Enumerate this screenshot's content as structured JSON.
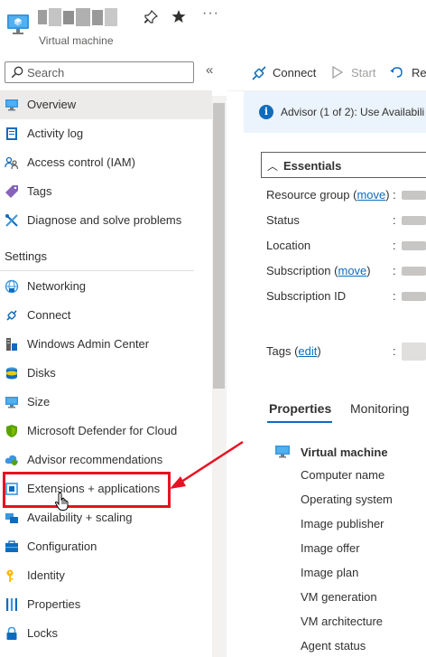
{
  "header": {
    "vm_subtitle": "Virtual machine",
    "pin_icon": "pin-icon",
    "star_icon": "star-icon",
    "more_label": "···"
  },
  "sidebar": {
    "search_placeholder": "Search",
    "collapse_label": "«",
    "items_top": [
      {
        "label": "Overview",
        "icon": "monitor-icon"
      },
      {
        "label": "Activity log",
        "icon": "activity-log-icon"
      },
      {
        "label": "Access control (IAM)",
        "icon": "people-icon"
      },
      {
        "label": "Tags",
        "icon": "tag-icon"
      },
      {
        "label": "Diagnose and solve problems",
        "icon": "wrench-icon"
      }
    ],
    "settings_title": "Settings",
    "items_settings": [
      {
        "label": "Networking",
        "icon": "network-icon"
      },
      {
        "label": "Connect",
        "icon": "connect-icon"
      },
      {
        "label": "Windows Admin Center",
        "icon": "admin-center-icon"
      },
      {
        "label": "Disks",
        "icon": "disks-icon"
      },
      {
        "label": "Size",
        "icon": "size-icon"
      },
      {
        "label": "Microsoft Defender for Cloud",
        "icon": "shield-icon"
      },
      {
        "label": "Advisor recommendations",
        "icon": "advisor-icon"
      },
      {
        "label": "Extensions + applications",
        "icon": "extensions-icon"
      },
      {
        "label": "Availability + scaling",
        "icon": "availability-icon"
      },
      {
        "label": "Configuration",
        "icon": "configuration-icon"
      },
      {
        "label": "Identity",
        "icon": "identity-key-icon"
      },
      {
        "label": "Properties",
        "icon": "properties-icon"
      },
      {
        "label": "Locks",
        "icon": "lock-icon"
      }
    ]
  },
  "toolbar": {
    "connect_label": "Connect",
    "start_label": "Start",
    "restart_label": "Res"
  },
  "advisor": {
    "text": "Advisor (1 of 2): Use Availabili"
  },
  "essentials": {
    "title": "Essentials",
    "rows": {
      "resource_group": "Resource group",
      "resource_group_link": "move",
      "status": "Status",
      "location": "Location",
      "subscription": "Subscription",
      "subscription_link": "move",
      "subscription_id": "Subscription ID",
      "tags": "Tags",
      "tags_link": "edit"
    }
  },
  "tabs": {
    "properties": "Properties",
    "monitoring": "Monitoring"
  },
  "vm_properties": {
    "section_title": "Virtual machine",
    "items": [
      "Computer name",
      "Operating system",
      "Image publisher",
      "Image offer",
      "Image plan",
      "VM generation",
      "VM architecture",
      "Agent status"
    ]
  },
  "colors": {
    "accent": "#0f6cbd",
    "highlight": "#e81123",
    "active_bg": "#edebe9"
  }
}
